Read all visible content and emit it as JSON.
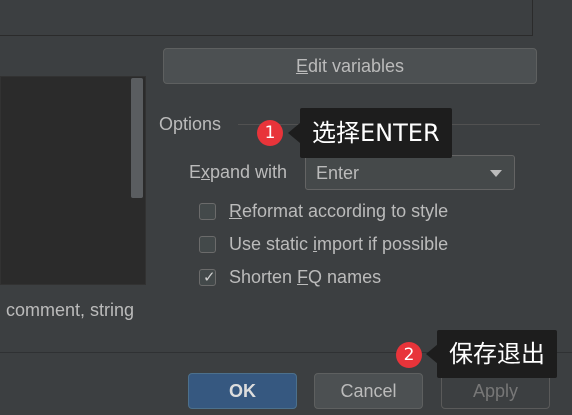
{
  "toolbar": {
    "edit_variables_prefix": "E",
    "edit_variables_rest": "dit variables"
  },
  "context": {
    "text": "comment, string"
  },
  "options": {
    "title": "Options",
    "expand_with_prefix": "E",
    "expand_with_underline": "x",
    "expand_with_rest": "pand with",
    "expand_value": "Enter",
    "checkboxes": [
      {
        "pre": "",
        "u": "R",
        "post": "eformat according to style",
        "checked": false
      },
      {
        "pre": "Use static ",
        "u": "i",
        "post": "mport if possible",
        "checked": false
      },
      {
        "pre": "Shorten ",
        "u": "F",
        "post": "Q names",
        "checked": true
      }
    ]
  },
  "buttons": {
    "ok": "OK",
    "cancel": "Cancel",
    "apply": "Apply"
  },
  "annotations": [
    {
      "number": "1",
      "text": "选择ENTER"
    },
    {
      "number": "2",
      "text": "保存退出"
    }
  ],
  "colors": {
    "background": "#3c3f41",
    "ok_button": "#365880",
    "badge": "#e8343a",
    "callout": "#1d1d1d"
  }
}
